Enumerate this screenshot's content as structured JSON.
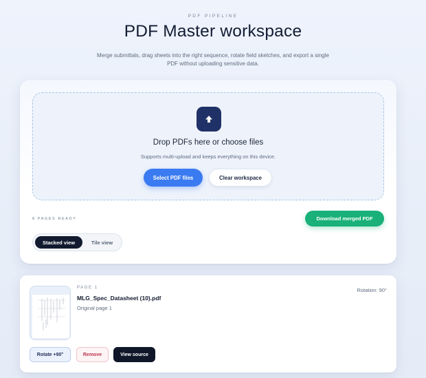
{
  "header": {
    "eyebrow": "PDF PIPELINE",
    "title": "PDF Master workspace",
    "subtitle": "Merge submittals, drag sheets into the right sequence, rotate field sketches, and export a single PDF without uploading sensitive data."
  },
  "dropzone": {
    "icon": "upload-arrow-icon",
    "title": "Drop PDFs here or choose files",
    "subtitle": "Supports multi-upload and keeps everything on this device.",
    "select_label": "Select PDF files",
    "clear_label": "Clear workspace"
  },
  "status": {
    "pages_ready": "8 PAGES READY",
    "download_label": "Download merged PDF"
  },
  "view_toggle": {
    "options": [
      "Stacked view",
      "Tile view"
    ],
    "active": "Stacked view"
  },
  "pages": [
    {
      "page_label": "PAGE 1",
      "file_name": "MLG_Spec_Datasheet (10).pdf",
      "original": "Original page 1",
      "rotation": "Rotation: 90°",
      "rotate_label": "Rotate +90°",
      "remove_label": "Remove",
      "view_label": "View source"
    }
  ],
  "colors": {
    "primary": "#3b7bf1",
    "success": "#19b07a",
    "dark": "#111a2e",
    "danger": "#b9384e"
  }
}
